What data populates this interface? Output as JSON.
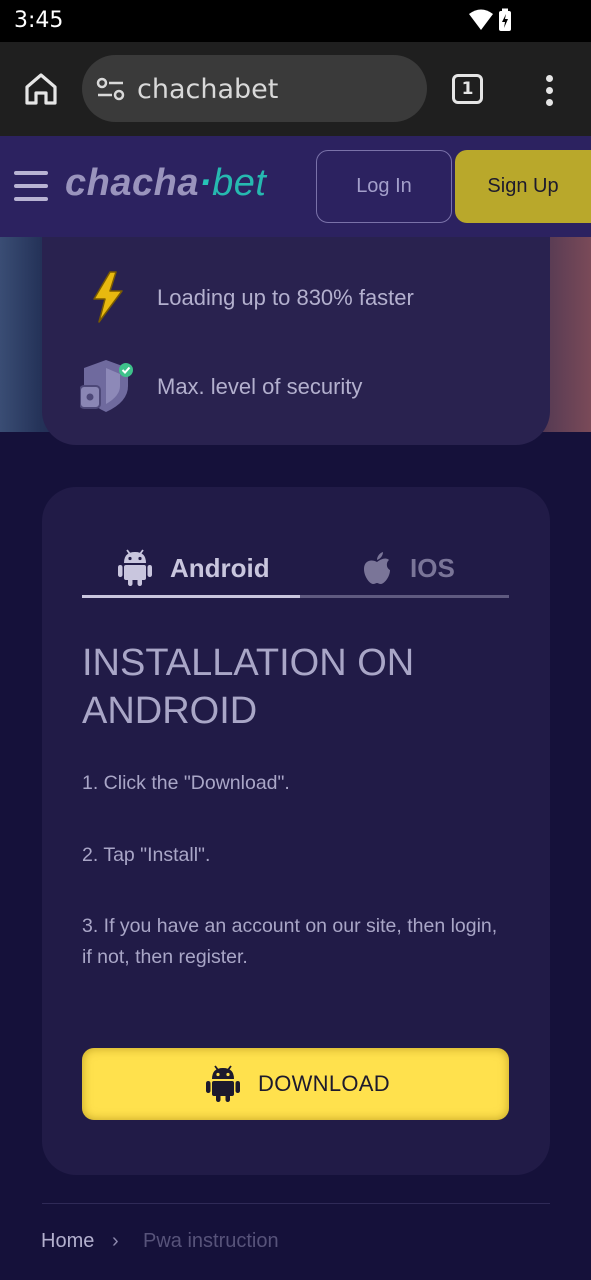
{
  "status_bar": {
    "time": "3:45"
  },
  "browser": {
    "url": "chachabet",
    "tab_count": "1"
  },
  "site_header": {
    "logo_part1": "chacha",
    "logo_dot": "·",
    "logo_part2": "bet",
    "login_label": "Log In",
    "signup_label": "Sign Up"
  },
  "features": [
    {
      "text": "Loading up to 830% faster",
      "icon": "lightning-icon"
    },
    {
      "text": "Max. level of security",
      "icon": "shield-icon"
    }
  ],
  "install_card": {
    "tabs": [
      {
        "label": "Android",
        "icon": "android-icon",
        "active": true
      },
      {
        "label": "IOS",
        "icon": "apple-icon",
        "active": false
      }
    ],
    "title": "INSTALLATION ON ANDROID",
    "steps": [
      "1. Click the \"Download\".",
      "2. Tap \"Install\".",
      "3. If you have an account on our site, then login, if not, then register."
    ],
    "download_label": "DOWNLOAD"
  },
  "breadcrumb": {
    "home": "Home",
    "separator": "›",
    "current": "Pwa instruction"
  },
  "colors": {
    "page_bg": "#15113a",
    "header_bg": "#2c2260",
    "card_bg": "#211b47",
    "accent_yellow": "#ffe14d",
    "signup_yellow": "#b9a82b",
    "logo_teal": "#26b9b0"
  }
}
